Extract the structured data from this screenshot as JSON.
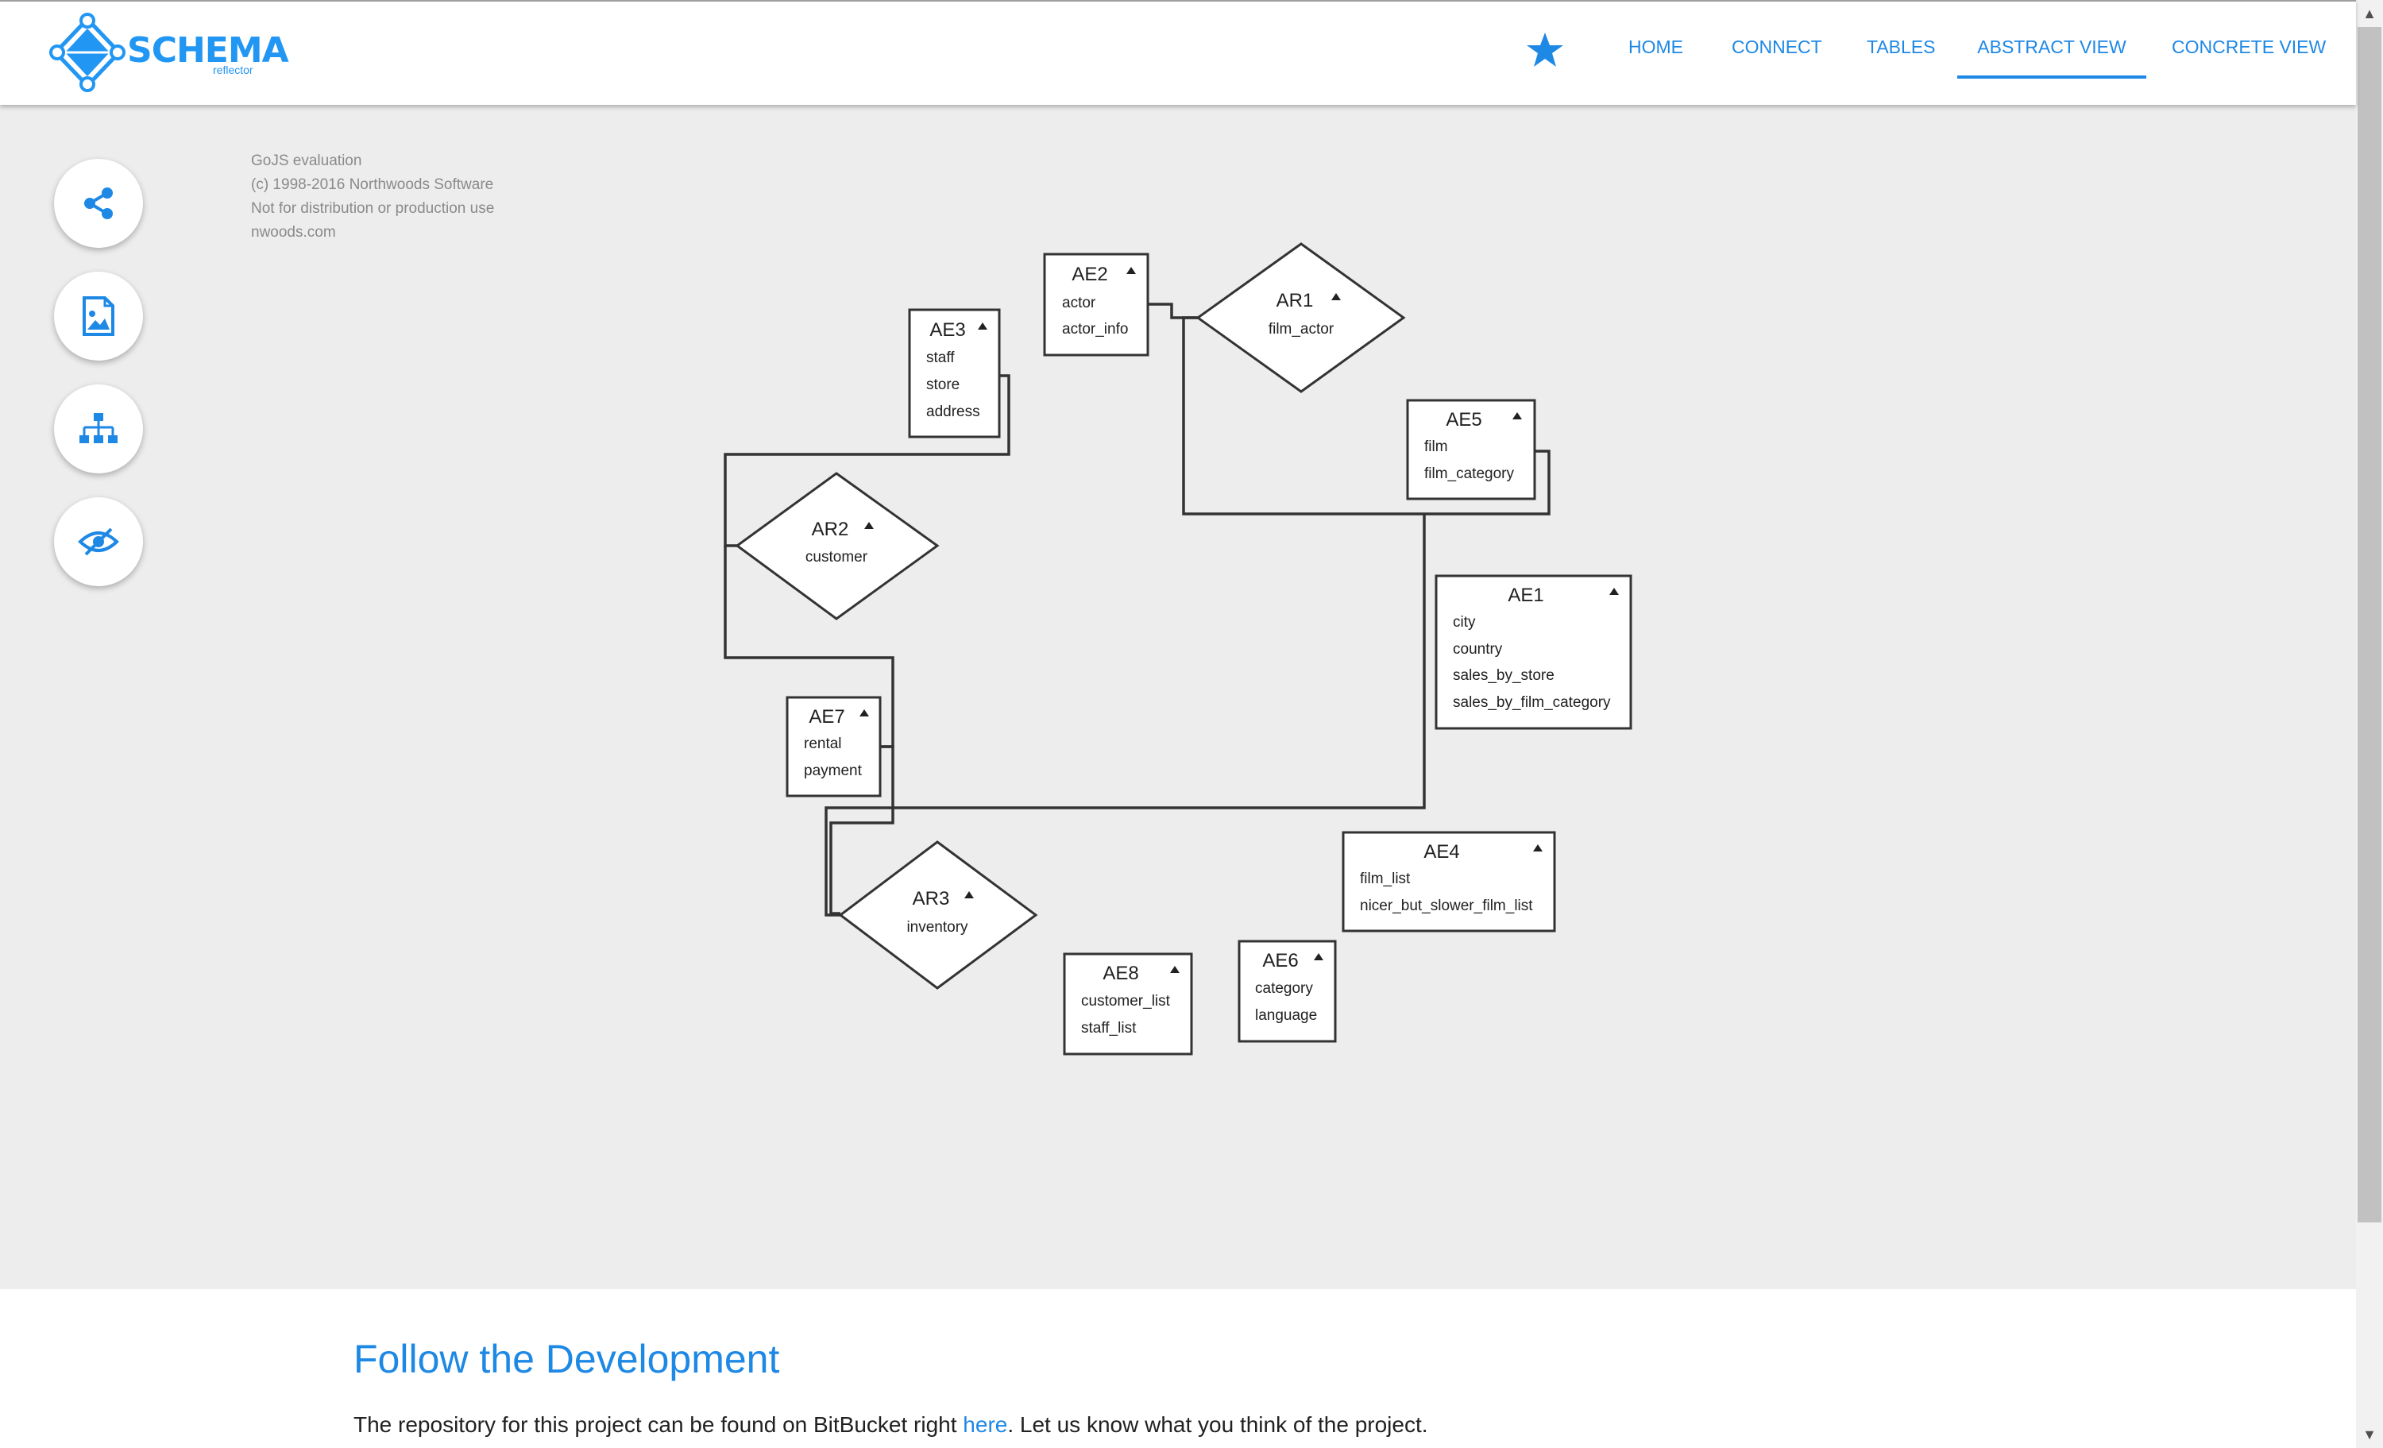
{
  "app": {
    "brand": "SCHEMA",
    "brand_sub": "reflector",
    "accent_color": "#2196f3"
  },
  "nav": {
    "star_icon": "star-icon",
    "items": [
      {
        "label": "HOME",
        "active": false
      },
      {
        "label": "CONNECT",
        "active": false
      },
      {
        "label": "TABLES",
        "active": false
      },
      {
        "label": "ABSTRACT VIEW",
        "active": true
      },
      {
        "label": "CONCRETE VIEW",
        "active": false
      }
    ]
  },
  "tools": [
    {
      "icon": "share-icon"
    },
    {
      "icon": "image-file-icon"
    },
    {
      "icon": "hierarchy-icon"
    },
    {
      "icon": "eye-icon"
    }
  ],
  "watermark": {
    "lines": [
      "GoJS evaluation",
      "(c) 1998-2016 Northwoods Software",
      "Not for distribution or production use",
      "nwoods.com"
    ]
  },
  "diagram": {
    "entities": [
      {
        "id": "AE2",
        "items": [
          "actor",
          "actor_info"
        ]
      },
      {
        "id": "AE3",
        "items": [
          "staff",
          "store",
          "address"
        ]
      },
      {
        "id": "AE5",
        "items": [
          "film",
          "film_category"
        ]
      },
      {
        "id": "AE1",
        "items": [
          "city",
          "country",
          "sales_by_store",
          "sales_by_film_category"
        ]
      },
      {
        "id": "AE7",
        "items": [
          "rental",
          "payment"
        ]
      },
      {
        "id": "AE4",
        "items": [
          "film_list",
          "nicer_but_slower_film_list"
        ]
      },
      {
        "id": "AE8",
        "items": [
          "customer_list",
          "staff_list"
        ]
      },
      {
        "id": "AE6",
        "items": [
          "category",
          "language"
        ]
      }
    ],
    "relationships": [
      {
        "id": "AR1",
        "label": "film_actor"
      },
      {
        "id": "AR2",
        "label": "customer"
      },
      {
        "id": "AR3",
        "label": "inventory"
      }
    ]
  },
  "footer": {
    "title": "Follow the Development",
    "text_before": "The repository for this project can be found on BitBucket right ",
    "link": "here",
    "text_after": ". Let us know what you think of the project."
  }
}
